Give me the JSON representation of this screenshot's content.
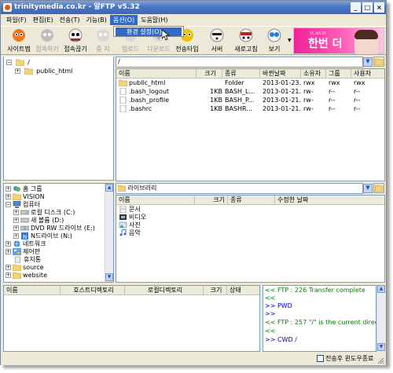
{
  "window": {
    "title": "trinitymedia.co.kr - 알FTP v5.32",
    "minimize": "_",
    "maximize": "□",
    "close": "×"
  },
  "menu": [
    {
      "label": "파일(F)"
    },
    {
      "label": "편집(E)"
    },
    {
      "label": "전송(T)"
    },
    {
      "label": "기능(B)"
    },
    {
      "label": "옵션(O)"
    },
    {
      "label": "도움말(H)"
    }
  ],
  "dropdown": {
    "item": "환경 설정(O)..."
  },
  "toolbar": {
    "buttons": [
      {
        "label": "사이트맵",
        "enabled": true,
        "color": "#f07820"
      },
      {
        "label": "접속하기",
        "enabled": false,
        "color": "#999999"
      },
      {
        "label": "접속끊기",
        "enabled": true,
        "color": "#e0e0e0"
      },
      {
        "label": "중 지",
        "enabled": false,
        "color": "#bbbbbb"
      },
      {
        "label": "업로드",
        "enabled": false,
        "color": "#bbbbbb"
      },
      {
        "label": "다운로드",
        "enabled": false,
        "color": "#bbbbbb"
      },
      {
        "label": "전송타입",
        "enabled": true,
        "color": "#f0c000"
      },
      {
        "label": "서버",
        "enabled": true,
        "color": "#202020"
      },
      {
        "label": "새로고침",
        "enabled": true,
        "color": "#c02020"
      },
      {
        "label": "보기",
        "enabled": true,
        "color": "#2080e0"
      }
    ],
    "banner_small": "15.345.55",
    "banner_text": "한번 더"
  },
  "remote": {
    "tree_path": "/",
    "tree": [
      {
        "label": "/",
        "level": 0,
        "expander": "−"
      },
      {
        "label": "public_html",
        "level": 1,
        "expander": "+"
      }
    ],
    "path": "/",
    "columns": [
      "이름",
      "크기",
      "종류",
      "바뀐날짜",
      "소유자",
      "그룹",
      "사용자"
    ],
    "files": [
      {
        "name": "public_html",
        "size": "",
        "type": "Folder",
        "date": "2013-01-23...",
        "owner": "rwx",
        "group": "rwx",
        "user": "rwx",
        "icon": "folder"
      },
      {
        "name": ".bash_logout",
        "size": "1KB",
        "type": "BASH_L...",
        "date": "2013-01-21...",
        "owner": "rw-",
        "group": "r--",
        "user": "r--",
        "icon": "file"
      },
      {
        "name": ".bash_profile",
        "size": "1KB",
        "type": "BASH_P...",
        "date": "2013-01-21...",
        "owner": "rw-",
        "group": "r--",
        "user": "r--",
        "icon": "file"
      },
      {
        "name": ".bashrc",
        "size": "1KB",
        "type": "BASHR...",
        "date": "2013-01-21...",
        "owner": "rw-",
        "group": "r--",
        "user": "r--",
        "icon": "file"
      }
    ]
  },
  "local": {
    "tree": [
      {
        "label": "홈 그룹",
        "level": 0,
        "expander": "+",
        "icon": "home"
      },
      {
        "label": "VISION",
        "level": 0,
        "expander": "+",
        "icon": "folder"
      },
      {
        "label": "컴퓨터",
        "level": 0,
        "expander": "−",
        "icon": "computer"
      },
      {
        "label": "로컬 디스크 (C:)",
        "level": 1,
        "expander": "+",
        "icon": "drive"
      },
      {
        "label": "새 볼륨 (D:)",
        "level": 1,
        "expander": "+",
        "icon": "drive"
      },
      {
        "label": "DVD RW 드라이브 (E:)",
        "level": 1,
        "expander": "+",
        "icon": "dvd"
      },
      {
        "label": "N드라이브 (N:)",
        "level": 1,
        "expander": "+",
        "icon": "ndrive"
      },
      {
        "label": "네트워크",
        "level": 0,
        "expander": "+",
        "icon": "network"
      },
      {
        "label": "제어판",
        "level": 0,
        "expander": "+",
        "icon": "control"
      },
      {
        "label": "휴지통",
        "level": 0,
        "expander": "",
        "icon": "trash"
      },
      {
        "label": "source",
        "level": 0,
        "expander": "+",
        "icon": "folder"
      },
      {
        "label": "website",
        "level": 0,
        "expander": "+",
        "icon": "folder"
      }
    ],
    "path": "라이브러리",
    "columns": [
      "이름",
      "크기",
      "종류",
      "수정한 날짜"
    ],
    "files": [
      {
        "name": "문서",
        "icon": "doc"
      },
      {
        "name": "비디오",
        "icon": "video"
      },
      {
        "name": "사진",
        "icon": "photo"
      },
      {
        "name": "음악",
        "icon": "music"
      }
    ]
  },
  "queue": {
    "columns": [
      "이름",
      "호스트디렉토리",
      "로컬디렉토리",
      "크기",
      "상태"
    ]
  },
  "log": [
    {
      "text": "<< FTP : 226 Transfer complete",
      "color": "green"
    },
    {
      "text": "<<",
      "color": "green"
    },
    {
      "text": ">> PWD",
      "color": "blue"
    },
    {
      "text": ">>",
      "color": "blue"
    },
    {
      "text": "<< FTP : 257 \"/\" is the current directory",
      "color": "green"
    },
    {
      "text": "<<",
      "color": "green"
    },
    {
      "text": ">> CWD /",
      "color": "blue"
    }
  ],
  "status": {
    "checkbox_label": "전송후 윈도우종료",
    "checked": false
  }
}
